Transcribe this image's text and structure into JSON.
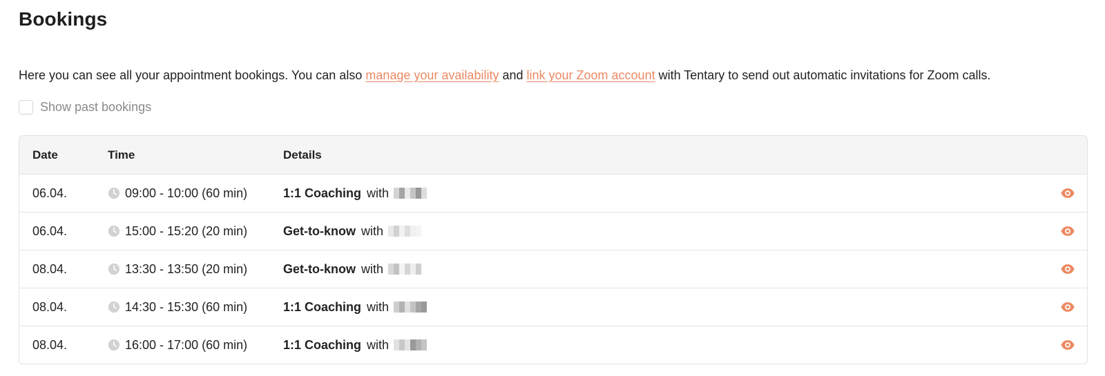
{
  "page": {
    "title": "Bookings"
  },
  "intro": {
    "text_before": "Here you can see all your appointment bookings. You can also ",
    "link_availability": "manage your availability",
    "text_middle": " and ",
    "link_zoom": "link your Zoom account",
    "text_after": " with Tentary to send out automatic invitations for Zoom calls."
  },
  "filters": {
    "show_past_label": "Show past bookings",
    "show_past_checked": false
  },
  "table": {
    "headers": {
      "date": "Date",
      "time": "Time",
      "details": "Details"
    },
    "rows": [
      {
        "date": "06.04.",
        "time": "09:00 - 10:00 (60 min)",
        "type": "1:1 Coaching",
        "with": "with"
      },
      {
        "date": "06.04.",
        "time": "15:00 - 15:20 (20 min)",
        "type": "Get-to-know",
        "with": "with"
      },
      {
        "date": "08.04.",
        "time": "13:30 - 13:50 (20 min)",
        "type": "Get-to-know",
        "with": "with"
      },
      {
        "date": "08.04.",
        "time": "14:30 - 15:30 (60 min)",
        "type": "1:1 Coaching",
        "with": "with"
      },
      {
        "date": "08.04.",
        "time": "16:00 - 17:00 (60 min)",
        "type": "1:1 Coaching",
        "with": "with"
      }
    ]
  },
  "icons": {
    "row_time": "clock-icon",
    "row_action": "eye-icon"
  },
  "colors": {
    "accent": "#ec8a63",
    "clock": "#cfcfcf",
    "header_bg": "#f5f5f5",
    "border": "#e2e2e2"
  }
}
